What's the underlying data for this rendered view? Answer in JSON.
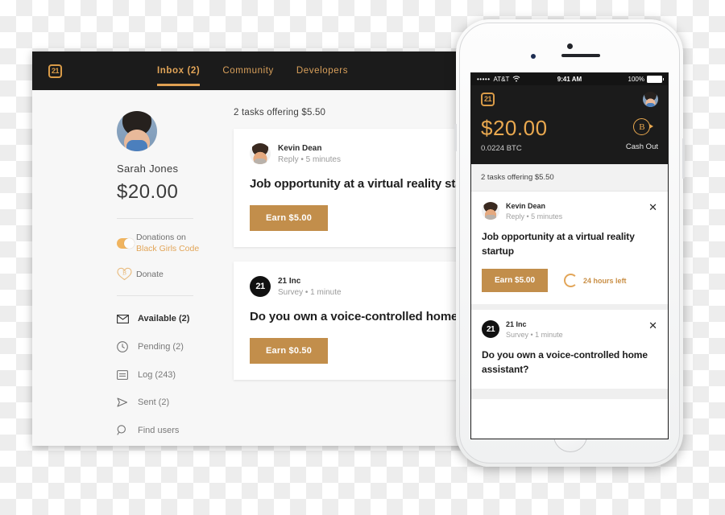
{
  "desktop": {
    "logo": "21",
    "nav": [
      {
        "label": "Inbox (2)",
        "active": true
      },
      {
        "label": "Community",
        "active": false
      },
      {
        "label": "Developers",
        "active": false
      }
    ],
    "sidebar": {
      "user_name": "Sarah Jones",
      "balance": "$20.00",
      "donation": {
        "toggle_state": "on",
        "line1": "Donations on",
        "line2": "Black Girls Code"
      },
      "donate_label": "Donate",
      "nav_items": [
        {
          "label": "Available (2)",
          "icon": "envelope-icon",
          "current": true
        },
        {
          "label": "Pending (2)",
          "icon": "clock-icon",
          "current": false
        },
        {
          "label": "Log (243)",
          "icon": "list-icon",
          "current": false
        },
        {
          "label": "Sent (2)",
          "icon": "send-icon",
          "current": false
        },
        {
          "label": "Find users",
          "icon": "search-icon",
          "current": false
        }
      ]
    },
    "feed": {
      "heading": "2 tasks offering $5.50",
      "tasks": [
        {
          "sender": "Kevin Dean",
          "meta": "Reply • 5 minutes",
          "title": "Job opportunity at a virtual reality startup",
          "button": "Earn $5.00",
          "avatar": "photo"
        },
        {
          "sender": "21 Inc",
          "meta": "Survey • 1 minute",
          "title": "Do you own a voice-controlled home assistant?",
          "button": "Earn $0.50",
          "avatar": "logo-21"
        }
      ]
    }
  },
  "phone": {
    "status_bar": {
      "signal_dots": "•••••",
      "carrier": "AT&T",
      "wifi": "wifi-icon",
      "time": "9:41 AM",
      "battery_pct": "100%"
    },
    "header": {
      "logo": "21",
      "amount": "$20.00",
      "btc": "0.0224 BTC",
      "cash_out_label": "Cash Out"
    },
    "feed_heading": "2 tasks offering $5.50",
    "tasks": [
      {
        "sender": "Kevin Dean",
        "meta": "Reply • 5 minutes",
        "title": "Job opportunity at a virtual reality startup",
        "button": "Earn $5.00",
        "timer": "24 hours left",
        "close": "✕",
        "avatar": "photo"
      },
      {
        "sender": "21 Inc",
        "meta": "Survey • 1 minute",
        "title": "Do you own a voice-controlled home assistant?",
        "button": "",
        "timer": "",
        "close": "✕",
        "avatar": "logo-21"
      }
    ]
  },
  "colors": {
    "accent_gold": "#e2a558",
    "button_gold": "#c28e4b",
    "dark_header": "#1b1b1b"
  }
}
